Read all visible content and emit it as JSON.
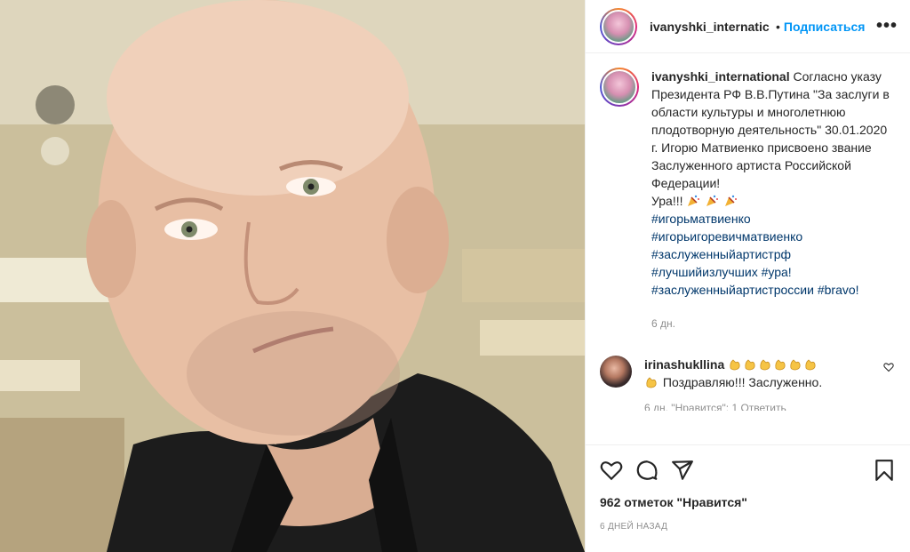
{
  "photo": {
    "alt_subject": "portrait-photo",
    "colors": {
      "background": "#c9bd98",
      "skin": "#e8bfa4",
      "shirt": "#1c1c1c"
    }
  },
  "post": {
    "username": "ivanyshki_internatic",
    "dot": "•",
    "follow_label": "Подписаться",
    "more_label": "•••"
  },
  "caption": {
    "username": "ivanyshki_international",
    "text": "Согласно указу Президента РФ В.В.Путина \"За заслуги в области культуры и многолетнюю плодотворную деятельность\" 30.01.2020 г. Игорю Матвиенко присвоено звание Заслуженного артиста Российской Федерации!",
    "cheer": "Ура!!!",
    "hashtags": [
      "#игорьматвиенко",
      "#игорьигоревичматвиенко",
      "#заслуженныйартистрф"
    ],
    "hashtag_line4a": "#лучшийизлучших",
    "hashtag_line4b": "#ура!",
    "hashtag_line5a": "#заслуженныйартистроссии",
    "hashtag_line5b": "#bravo!",
    "time": "6 дн."
  },
  "comment": {
    "username": "irinashukllina",
    "text": "Поздравляю!!! Заслуженно.",
    "next_preview": "6 дн.   \"Нравится\": 1   Ответить"
  },
  "footer": {
    "likes": "962 отметок \"Нравится\"",
    "timestamp": "6 ДНЕЙ НАЗАД"
  },
  "icons": [
    "heart-icon",
    "comment-icon",
    "share-icon",
    "bookmark-icon",
    "more-icon",
    "small-heart-icon",
    "party-popper-icon",
    "clapping-hands-icon"
  ],
  "colors": {
    "link": "#0095f6",
    "hashtag": "#00376b",
    "muted": "#8e8e8e",
    "text": "#262626"
  }
}
